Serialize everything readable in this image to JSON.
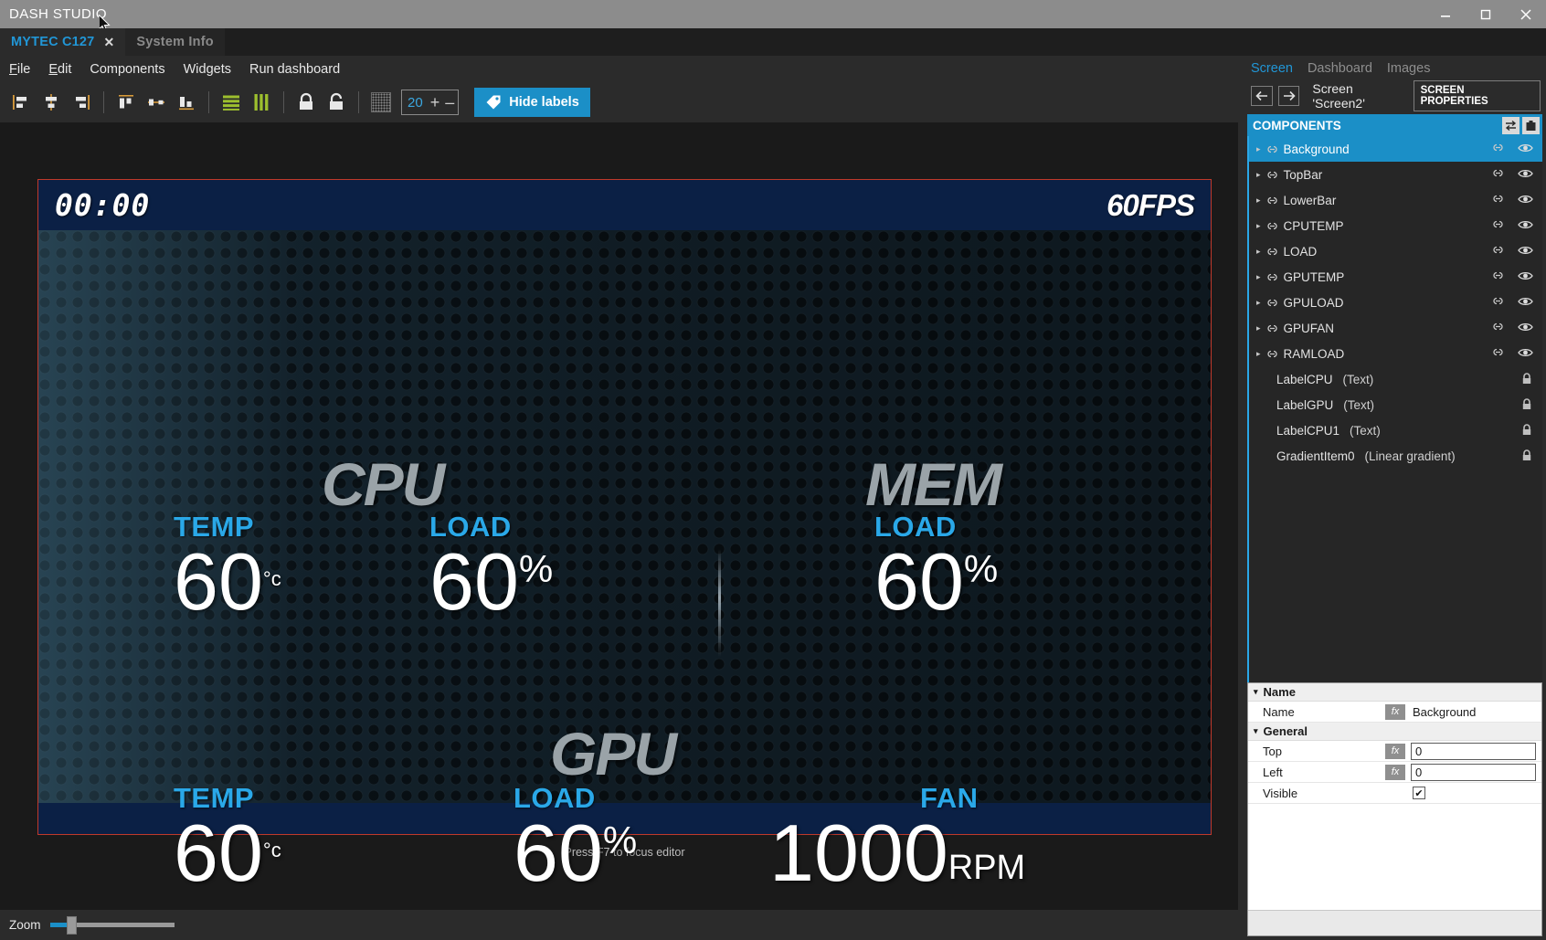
{
  "window": {
    "title": "DASH STUDIO",
    "controls": {
      "minimize": "–",
      "maximize": "❐",
      "close": "✕"
    }
  },
  "tabs": [
    {
      "label": "MYTEC C127",
      "close": "✕",
      "active": true
    },
    {
      "label": "System Info",
      "active": false
    }
  ],
  "menu": [
    {
      "label": "File"
    },
    {
      "label": "Edit"
    },
    {
      "label": "Components"
    },
    {
      "label": "Widgets"
    },
    {
      "label": "Run dashboard"
    }
  ],
  "toolbar": {
    "align_left": "align-left-icon",
    "align_center_v": "align-center-vertical-icon",
    "align_right": "align-right-icon",
    "align_top": "align-top-icon",
    "align_middle": "align-middle-icon",
    "align_bottom": "align-bottom-icon",
    "distribute_h": "distribute-horizontal-icon",
    "distribute_v": "distribute-vertical-icon",
    "lock": "lock-closed-icon",
    "unlock": "lock-open-icon",
    "grid": "grid-icon",
    "grid_size": "20",
    "plus": "+",
    "minus": "–",
    "hide_labels": "Hide labels",
    "hide_labels_icon": "tag-icon"
  },
  "dashboard": {
    "clock": "00:00",
    "fps": "60FPS",
    "cpu_brand": "CPU",
    "mem_brand": "MEM",
    "gpu_brand": "GPU",
    "metrics": [
      {
        "label": "TEMP",
        "value": "60",
        "unit": "°c",
        "unit_class": "unit-deg"
      },
      {
        "label": "LOAD",
        "value": "60",
        "unit": "%",
        "unit_class": "unit-pct"
      },
      {
        "label": "LOAD",
        "value": "60",
        "unit": "%",
        "unit_class": "unit-pct"
      },
      {
        "label": "TEMP",
        "value": "60",
        "unit": "°c",
        "unit_class": "unit-deg"
      },
      {
        "label": "LOAD",
        "value": "60",
        "unit": "%",
        "unit_class": "unit-pct"
      },
      {
        "label": "FAN",
        "value": "1000",
        "unit": "RPM",
        "unit_class": "unit-rpm"
      }
    ],
    "focus_hint": "Press F7 to focus editor"
  },
  "statusbar": {
    "zoom_label": "Zoom"
  },
  "rightpanel": {
    "tabs": [
      {
        "label": "Screen",
        "selected": true
      },
      {
        "label": "Dashboard",
        "selected": false
      },
      {
        "label": "Images",
        "selected": false
      }
    ],
    "nav": {
      "back": "←",
      "forward": "→",
      "screen_name": "Screen 'Screen2'",
      "screen_properties": "SCREEN PROPERTIES"
    },
    "components_header": "COMPONENTS",
    "header_icons": [
      "swap-icon",
      "clipboard-icon"
    ],
    "tree": [
      {
        "label": "Background",
        "type": "",
        "group": true,
        "selected": true,
        "icons": [
          "link-icon",
          "eye-icon"
        ]
      },
      {
        "label": "TopBar",
        "type": "",
        "group": true,
        "selected": false,
        "icons": [
          "link-icon",
          "eye-icon"
        ]
      },
      {
        "label": "LowerBar",
        "type": "",
        "group": true,
        "selected": false,
        "icons": [
          "link-icon",
          "eye-icon"
        ]
      },
      {
        "label": "CPUTEMP",
        "type": "",
        "group": true,
        "selected": false,
        "icons": [
          "link-icon",
          "eye-icon"
        ]
      },
      {
        "label": "LOAD",
        "type": "",
        "group": true,
        "selected": false,
        "icons": [
          "link-icon",
          "eye-icon"
        ]
      },
      {
        "label": "GPUTEMP",
        "type": "",
        "group": true,
        "selected": false,
        "icons": [
          "link-icon",
          "eye-icon"
        ]
      },
      {
        "label": "GPULOAD",
        "type": "",
        "group": true,
        "selected": false,
        "icons": [
          "link-icon",
          "eye-icon"
        ]
      },
      {
        "label": "GPUFAN",
        "type": "",
        "group": true,
        "selected": false,
        "icons": [
          "link-icon",
          "eye-icon"
        ]
      },
      {
        "label": "RAMLOAD",
        "type": "",
        "group": true,
        "selected": false,
        "icons": [
          "link-icon",
          "eye-icon"
        ]
      },
      {
        "label": "LabelCPU",
        "type": "(Text)",
        "group": false,
        "selected": false,
        "icons": [
          "lock-icon"
        ]
      },
      {
        "label": "LabelGPU",
        "type": "(Text)",
        "group": false,
        "selected": false,
        "icons": [
          "lock-icon"
        ]
      },
      {
        "label": "LabelCPU1",
        "type": "(Text)",
        "group": false,
        "selected": false,
        "icons": [
          "lock-icon"
        ]
      },
      {
        "label": "GradientItem0",
        "type": "(Linear gradient)",
        "group": false,
        "selected": false,
        "icons": [
          "lock-icon"
        ]
      }
    ],
    "properties": [
      {
        "kind": "category",
        "label": "Name"
      },
      {
        "kind": "row",
        "name": "Name",
        "fx": "fx",
        "value": "Background",
        "boxed": false,
        "checkbox": false
      },
      {
        "kind": "category",
        "label": "General"
      },
      {
        "kind": "row",
        "name": "Top",
        "fx": "fx",
        "value": "0",
        "boxed": true,
        "checkbox": false
      },
      {
        "kind": "row",
        "name": "Left",
        "fx": "fx",
        "value": "0",
        "boxed": true,
        "checkbox": false
      },
      {
        "kind": "row",
        "name": "Visible",
        "fx": "",
        "value": "✔",
        "boxed": false,
        "checkbox": true
      }
    ]
  },
  "colors": {
    "accent": "#1b8fc7",
    "accent_light": "#2aa8e8",
    "titlebar": "#8c8c8c",
    "panel": "#2b2b2b",
    "canvas": "#1a1a1a",
    "dash_bar": "#0b2045",
    "dash_border": "#c0392b",
    "metric_label": "#2aa8e8",
    "brand_gray": "#9aa3a8"
  }
}
